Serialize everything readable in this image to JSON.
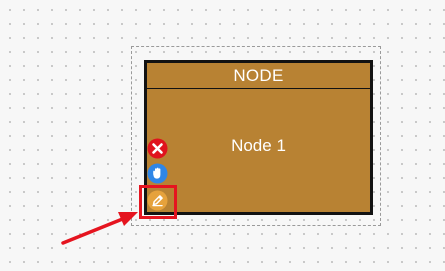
{
  "node": {
    "header": "NODE",
    "label": "Node 1"
  },
  "toolbar": [
    {
      "name": "delete-icon",
      "color": "#e0131d"
    },
    {
      "name": "drag-hand-icon",
      "color": "#2f86e6"
    },
    {
      "name": "edit-pencil-icon",
      "color": "#e6a23c"
    }
  ],
  "colors": {
    "node_fill": "#b88233",
    "node_border": "#121212",
    "highlight": "#e5141f",
    "selection_border": "#9a9a9a"
  }
}
